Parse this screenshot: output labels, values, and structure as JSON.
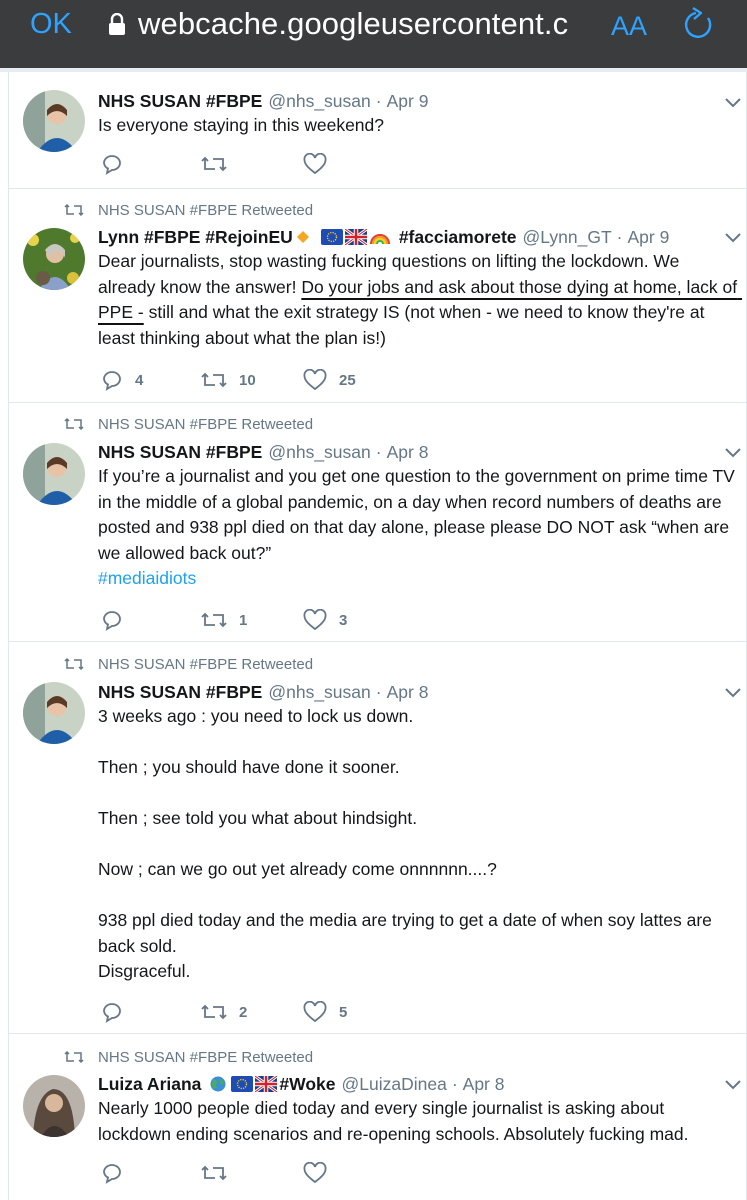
{
  "browser": {
    "done_label": "OK",
    "url": "webcache.googleusercontent.c",
    "text_size_label": "AA",
    "lock_icon": "lock-icon",
    "reload_icon": "reload-icon"
  },
  "colors": {
    "accent": "#2ea3ff",
    "link": "#1da1f2",
    "muted": "#657786",
    "text": "#14171a"
  },
  "tweets": [
    {
      "retweeted_by": "",
      "name": "NHS SUSAN #FBPE",
      "handle": "@nhs_susan",
      "separator": "·",
      "date": "Apr 9",
      "text": "Is everyone staying in this weekend?",
      "replies": "",
      "retweets": "",
      "likes": ""
    },
    {
      "retweeted_by": "NHS SUSAN #FBPE Retweeted",
      "name": "Lynn #FBPE #RejoinEU",
      "name_suffix": "#facciamorete",
      "handle": "@Lynn_GT",
      "separator": "·",
      "date": "Apr 9",
      "text_parts": [
        "Dear journalists, stop wasting fucking questions on lifting the lockdown. We already know the answer! ",
        "Do your jobs and ask about those dying at home, lack of PPE -",
        " still and what the exit strategy IS (not when - we need to know they're at least thinking about what the plan is!)"
      ],
      "replies": "4",
      "retweets": "10",
      "likes": "25"
    },
    {
      "retweeted_by": "NHS SUSAN #FBPE Retweeted",
      "name": "NHS SUSAN #FBPE",
      "handle": "@nhs_susan",
      "separator": "·",
      "date": "Apr 8",
      "text": "If you’re a journalist and you get one question to the government on prime time TV in the middle of a global pandemic, on a day when record numbers of deaths are posted and 938 ppl died on that day alone, please please DO NOT ask “when are we allowed back out?”",
      "hashtag": "#mediaidiots",
      "replies": "",
      "retweets": "1",
      "likes": "3"
    },
    {
      "retweeted_by": "NHS SUSAN #FBPE Retweeted",
      "name": "NHS SUSAN #FBPE",
      "handle": "@nhs_susan",
      "separator": "·",
      "date": "Apr 8",
      "text": "3 weeks ago : you need to lock us down.\n\nThen ; you should have done it sooner.\n\nThen ; see told you what about hindsight.\n\nNow ; can we go out yet already come onnnnnn....?\n\n938 ppl died today and the media are trying to get a date of when soy lattes are back sold.\nDisgraceful.",
      "replies": "",
      "retweets": "2",
      "likes": "5"
    },
    {
      "retweeted_by": "NHS SUSAN #FBPE Retweeted",
      "name": "Luiza Ariana",
      "name_suffix": "#Woke",
      "handle": "@LuizaDinea",
      "separator": "·",
      "date": "Apr 8",
      "text": "Nearly 1000 people died today and every single journalist is asking about lockdown ending scenarios and re-opening schools. Absolutely fucking mad.",
      "replies": "",
      "retweets": "",
      "likes": ""
    }
  ]
}
